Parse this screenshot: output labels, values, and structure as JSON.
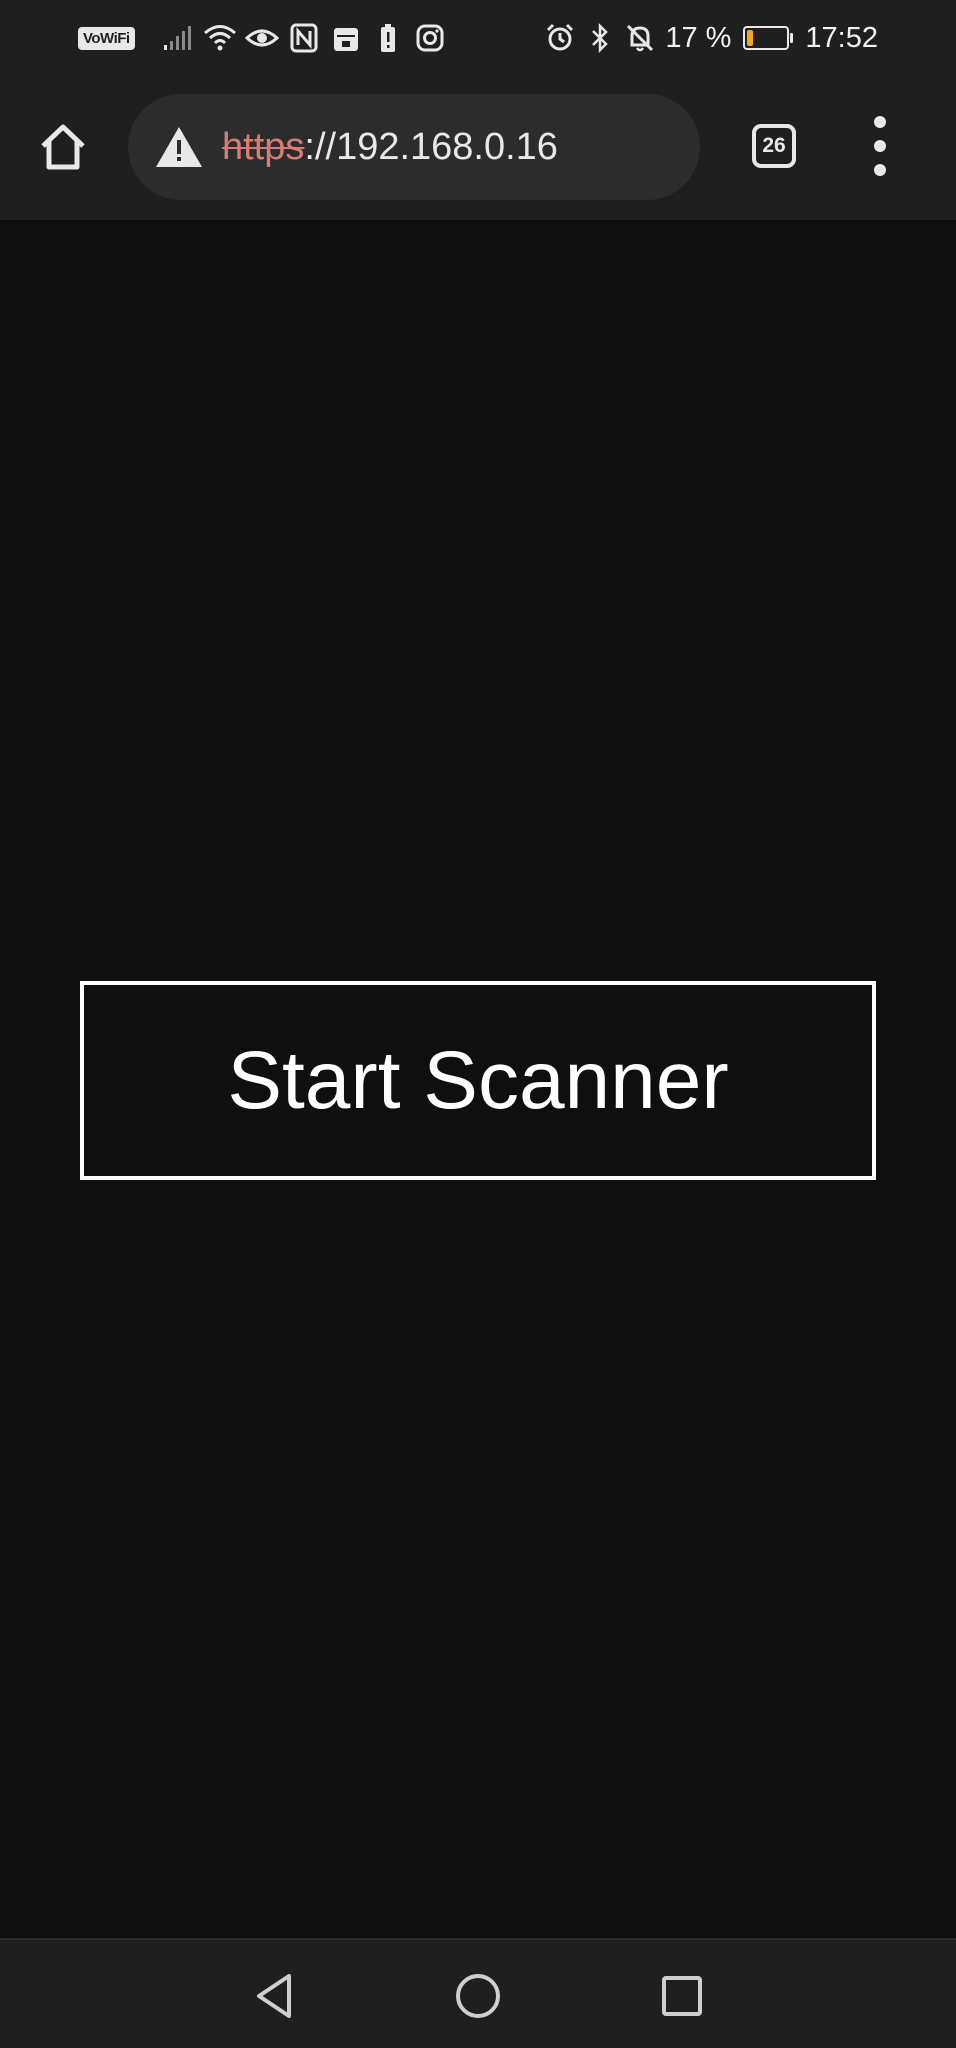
{
  "status_bar": {
    "vowifi_label": "VoWiFi",
    "battery_percent": "17 %",
    "battery_level": 0.17,
    "time": "17:52",
    "left_icons": [
      "signal-icon",
      "wifi-icon",
      "eye-icon",
      "nfc-icon",
      "calendar-icon",
      "battery-alert-icon",
      "instagram-icon"
    ],
    "right_icons": [
      "alarm-icon",
      "bluetooth-icon",
      "bell-off-icon"
    ],
    "colors": {
      "battery_fill": "#f5a623"
    }
  },
  "toolbar": {
    "url_scheme": "https",
    "url_rest": "://192.168.0.16",
    "tab_count": "26",
    "colors": {
      "url_scheme": "#d77b74"
    }
  },
  "main": {
    "start_button_label": "Start Scanner"
  },
  "nav_bar": {
    "buttons": [
      "back-icon",
      "home-icon",
      "recents-icon"
    ]
  }
}
